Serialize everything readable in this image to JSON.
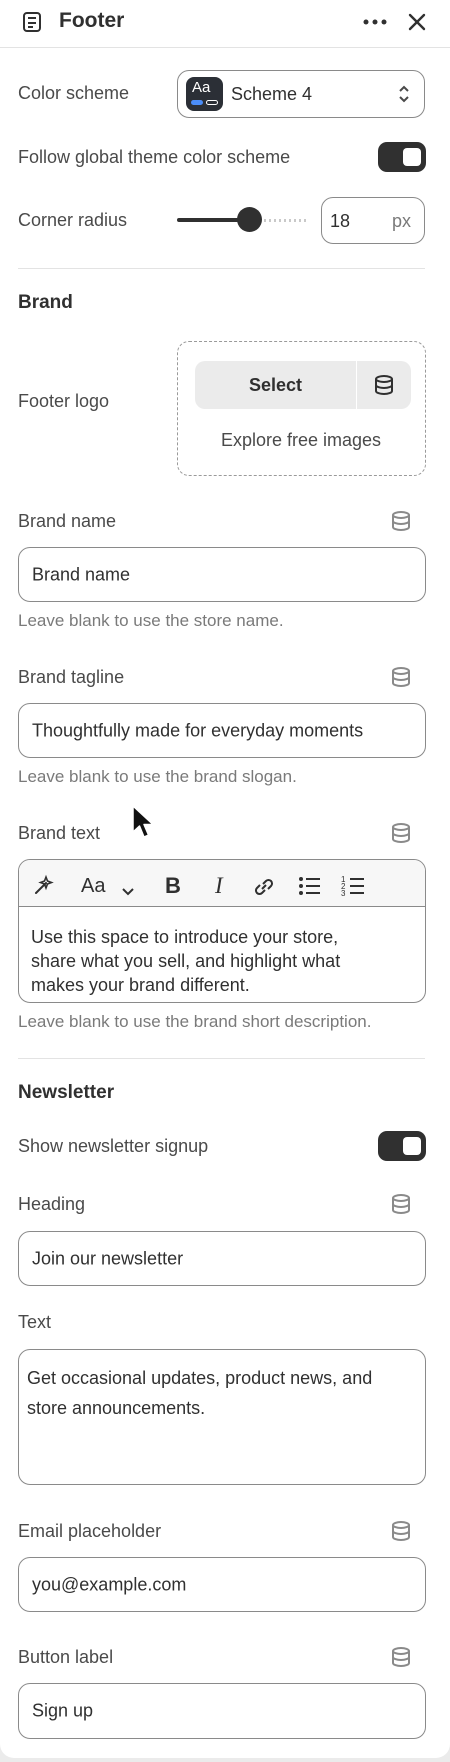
{
  "header": {
    "title": "Footer"
  },
  "color_scheme": {
    "label": "Color scheme",
    "value": "Scheme 4",
    "swatch_text": "Aa"
  },
  "follow_global": {
    "label": "Follow global theme color scheme",
    "on": true
  },
  "corner_radius": {
    "label": "Corner radius",
    "value": "18",
    "unit": "px",
    "slider_fraction": 0.56
  },
  "brand": {
    "title": "Brand",
    "logo": {
      "label": "Footer logo",
      "select": "Select",
      "explore": "Explore free images"
    },
    "name": {
      "label": "Brand name",
      "value": "Brand name",
      "help": "Leave blank to use the store name."
    },
    "tagline": {
      "label": "Brand tagline",
      "value": "Thoughtfully made for everyday moments",
      "help": "Leave blank to use the brand slogan."
    },
    "text": {
      "label": "Brand text",
      "line1": "Use this space to introduce your store,",
      "line2": "share what you sell, and highlight what",
      "line3": "makes your brand different.",
      "help": "Leave blank to use the brand short description.",
      "toolbar_font": "Aa"
    }
  },
  "newsletter": {
    "title": "Newsletter",
    "show": {
      "label": "Show newsletter signup",
      "on": true
    },
    "heading": {
      "label": "Heading",
      "value": "Join our newsletter"
    },
    "text": {
      "label": "Text",
      "line1": "Get occasional updates, product news, and",
      "line2": "store announcements."
    },
    "email": {
      "label": "Email placeholder",
      "value": "you@example.com"
    },
    "button": {
      "label": "Button label",
      "value": "Sign up"
    }
  }
}
